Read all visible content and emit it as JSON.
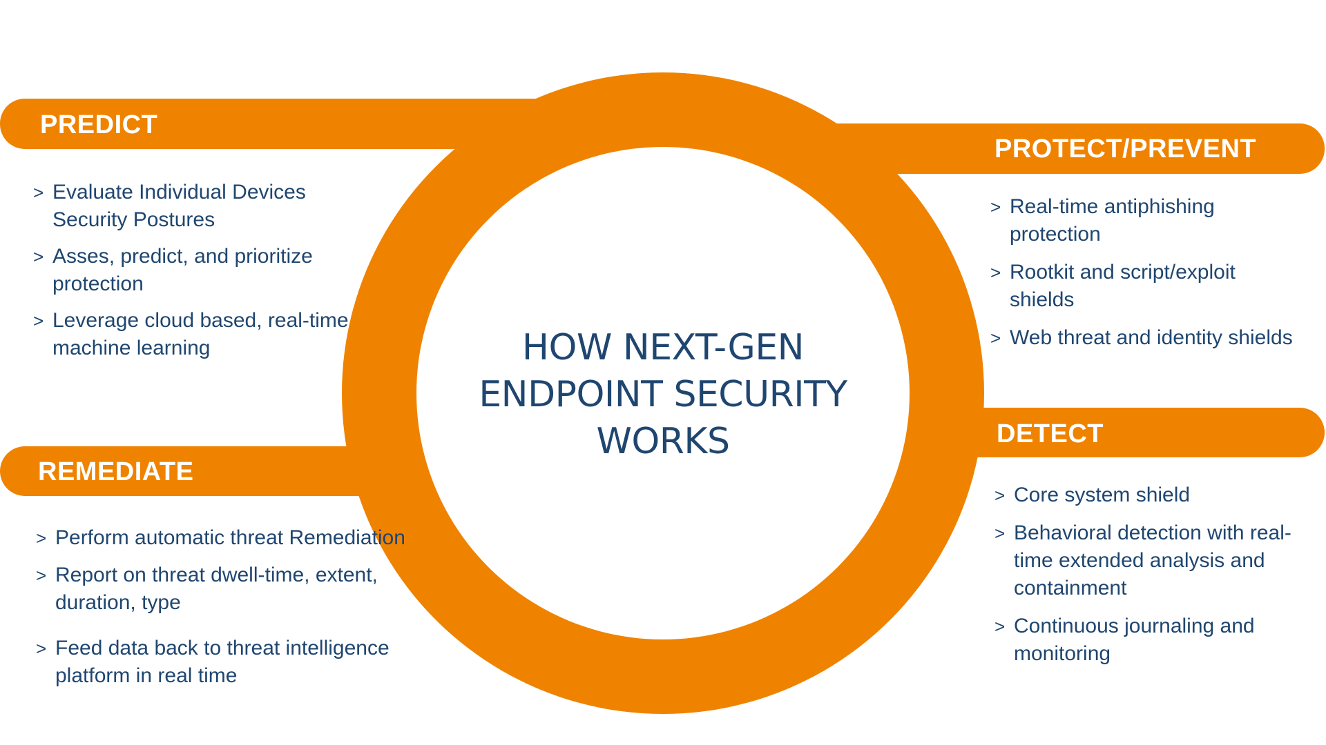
{
  "title": {
    "lines": [
      "HOW NEXT-GEN",
      "ENDPOINT SECURITY",
      "WORKS"
    ]
  },
  "colors": {
    "accent": "#EF8300",
    "text": "#1F4670",
    "bar_text": "#FFFFFF",
    "background": "#FFFFFF"
  },
  "bullet_glyph": ">",
  "sections": {
    "predict": {
      "label": "PREDICT",
      "items": [
        "Evaluate Individual Devices Security Postures",
        "Asses, predict, and prioritize protection",
        "Leverage cloud based, real-time machine learning"
      ]
    },
    "protect": {
      "label": "PROTECT/PREVENT",
      "items": [
        "Real-time antiphishing protection",
        "Rootkit and script/exploit shields",
        "Web threat and identity shields"
      ]
    },
    "detect": {
      "label": "DETECT",
      "items": [
        "Core system shield",
        "Behavioral detection with real-time extended analysis and containment",
        "Continuous journaling and monitoring"
      ]
    },
    "remediate": {
      "label": "REMEDIATE",
      "items": [
        "Perform automatic threat Remediation",
        "Report on threat dwell-time, extent, duration, type",
        "Feed data back to threat intelligence platform in real time"
      ]
    }
  }
}
